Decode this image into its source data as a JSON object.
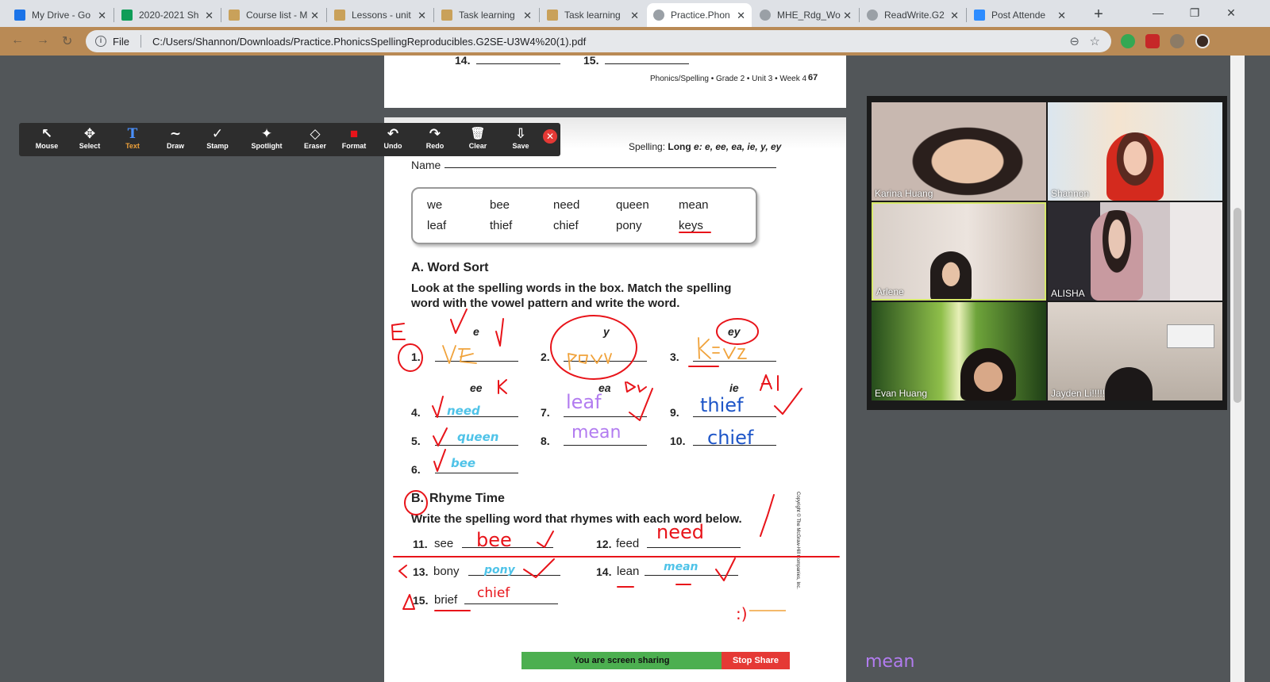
{
  "browser": {
    "tabs": [
      {
        "label": "My Drive - Go",
        "icon_color": "#1a73e8"
      },
      {
        "label": "2020-2021 Sh",
        "icon_color": "#0f9d58"
      },
      {
        "label": "Course list - M",
        "icon_color": "#c9a15a"
      },
      {
        "label": "Lessons - unit",
        "icon_color": "#c9a15a"
      },
      {
        "label": "Task learning",
        "icon_color": "#c9a15a"
      },
      {
        "label": "Task learning",
        "icon_color": "#c9a15a"
      },
      {
        "label": "Practice.Phon",
        "icon_color": "#9aa0a6"
      },
      {
        "label": "MHE_Rdg_Wo",
        "icon_color": "#9aa0a6"
      },
      {
        "label": "ReadWrite.G2",
        "icon_color": "#9aa0a6"
      },
      {
        "label": "Post Attende",
        "icon_color": "#2d8cff"
      }
    ],
    "close_glyph": "✕",
    "new_tab": "+",
    "min": "—",
    "restore": "❐",
    "close": "✕",
    "back": "←",
    "forward": "→",
    "reload": "↻",
    "info": "i",
    "file_label": "File",
    "url": "C:/Users/Shannon/Downloads/Practice.PhonicsSpellingReproducibles.G2SE-U3W4%20(1).pdf",
    "zoom_icon": "⊖",
    "star_icon": "☆"
  },
  "pdf_prev_page": {
    "q14": "14.",
    "q15": "15.",
    "footer": "Phonics/Spelling • Grade 2 • Unit 3 • Week 4",
    "page_num": "67"
  },
  "zoom_toolbar": {
    "tools": [
      {
        "label": "Mouse",
        "icon": "↖"
      },
      {
        "label": "Select",
        "icon": "✥"
      },
      {
        "label": "Text",
        "icon": "T"
      },
      {
        "label": "Draw",
        "icon": "∼"
      },
      {
        "label": "Stamp",
        "icon": "✓"
      },
      {
        "label": "Spotlight",
        "icon": "✦"
      },
      {
        "label": "Eraser",
        "icon": "◇"
      },
      {
        "label": "Format",
        "icon": "■"
      },
      {
        "label": "Undo",
        "icon": "↶"
      },
      {
        "label": "Redo",
        "icon": "↷"
      },
      {
        "label": "Clear",
        "icon": "🗑"
      },
      {
        "label": "Save",
        "icon": "⇩"
      }
    ],
    "close": "✕"
  },
  "worksheet": {
    "header_prefix": "Spelling: ",
    "header_bold": "Long ",
    "header_italic": "e: e, ee, ea, ie, y, ey",
    "name_label": "Name",
    "word_box": [
      [
        "we",
        "bee",
        "need",
        "queen",
        "mean"
      ],
      [
        "leaf",
        "thief",
        "chief",
        "pony",
        "keys"
      ]
    ],
    "section_a_title": "A. Word Sort",
    "section_a_instructions_1": "Look at the spelling words in the box. Match the spelling",
    "section_a_instructions_2": "word with the vowel pattern and write the word.",
    "patterns": {
      "e": "e",
      "y": "y",
      "ey": "ey",
      "ee": "ee",
      "ea": "ea",
      "ie": "ie"
    },
    "numbers": [
      "1.",
      "2.",
      "3.",
      "4.",
      "5.",
      "6.",
      "7.",
      "8.",
      "9.",
      "10."
    ],
    "answers_typed": {
      "a4": "need",
      "a5": "queen",
      "a6": "bee",
      "a7": "leaf",
      "a8": "mean",
      "a9": "thief",
      "a10": "chief"
    },
    "section_b_title": "Rhyme Time",
    "section_b_letter": "B.",
    "section_b_instructions": "Write the spelling word that rhymes with each word below.",
    "rhyme_items": [
      {
        "num": "11.",
        "word": "see",
        "answer": "bee"
      },
      {
        "num": "12.",
        "word": "feed",
        "answer": "need"
      },
      {
        "num": "13.",
        "word": "bony",
        "answer": "pony"
      },
      {
        "num": "14.",
        "word": "lean",
        "answer": "mean"
      },
      {
        "num": "15.",
        "word": "brief",
        "answer": "chief"
      }
    ],
    "copyright": "Copyright © The McGraw-Hill Companies, Inc.",
    "smiley": ":)"
  },
  "video_panel": {
    "participants": [
      "Karina Huang",
      "Shannon",
      "Arlene",
      "ALISHA",
      "Evan Huang",
      "Jayden Li!!!!!"
    ]
  },
  "share_bar": {
    "status": "You are screen sharing",
    "stop": "Stop Share"
  },
  "stray_text": "mean"
}
